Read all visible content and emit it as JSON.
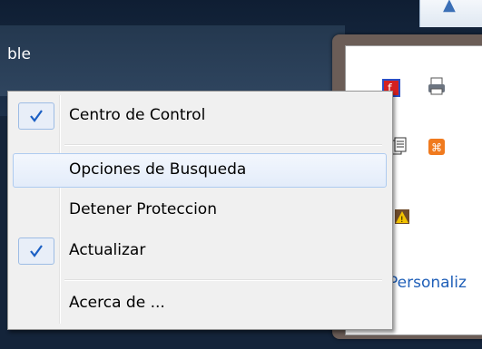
{
  "background": {
    "label": "ble"
  },
  "tray": {
    "link_text": "Personaliz"
  },
  "menu": {
    "items": [
      {
        "label": "Centro de Control",
        "checked": true
      },
      {
        "label": "Opciones de Busqueda",
        "checked": false,
        "highlighted": true
      },
      {
        "label": "Detener Proteccion",
        "checked": false
      },
      {
        "label": "Actualizar",
        "checked": true
      },
      {
        "label": "Acerca de ...",
        "checked": false
      }
    ]
  },
  "colors": {
    "check": "#1b5fc4",
    "highlight_border": "#aecbf0",
    "link": "#1f5fb8"
  }
}
